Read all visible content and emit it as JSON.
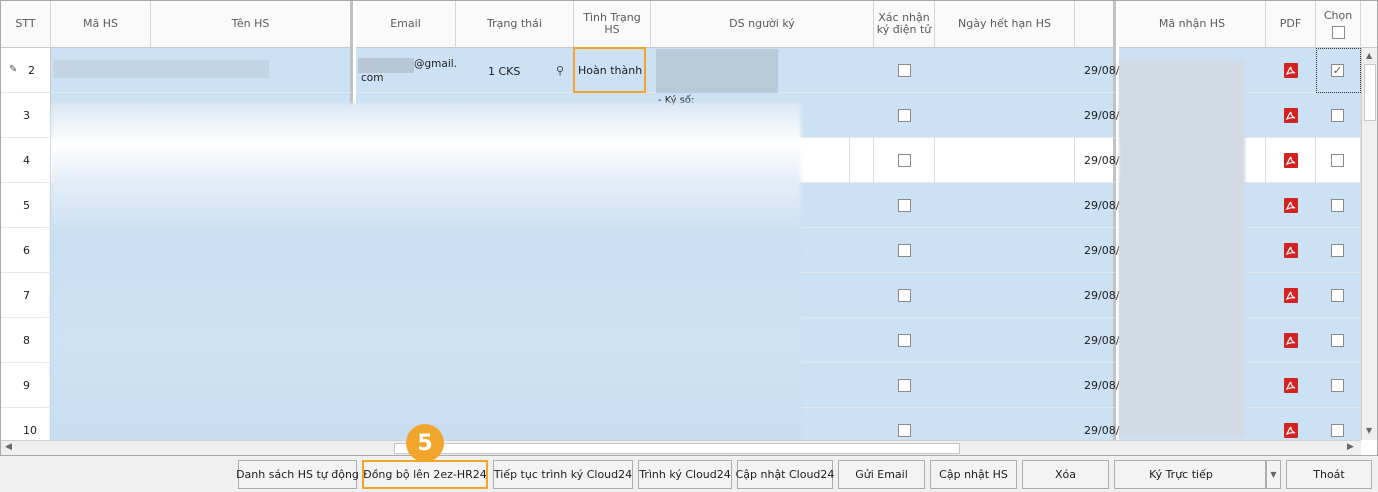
{
  "columns": {
    "stt": "STT",
    "ma_hs": "Mã HS",
    "ten_hs": "Tên HS",
    "email": "Email",
    "trang_thai": "Trạng thái",
    "tinh_trang_hs": "Tình Trạng HS",
    "ds_nguoi_ky": "DS người ký",
    "xac_nhan_1": "Xác nhận",
    "xac_nhan_2": "ký điện tử",
    "ngay_het_han": "Ngày hết hạn HS",
    "ma_nhan_hs": "Mã nhận HS",
    "pdf": "PDF",
    "chon": "Chọn"
  },
  "first_row": {
    "stt": "2",
    "email_line1": "@gmail.",
    "email_line2": "com",
    "trang_thai": "1 CKS",
    "tinh_trang": "Hoàn thành",
    "ds_partial": "- Ký số:"
  },
  "rows": [
    {
      "stt": "2",
      "date": "29/08/"
    },
    {
      "stt": "3",
      "date": "29/08/"
    },
    {
      "stt": "4",
      "date": "29/08/"
    },
    {
      "stt": "5",
      "date": "29/08/"
    },
    {
      "stt": "6",
      "date": "29/08/"
    },
    {
      "stt": "7",
      "date": "29/08/"
    },
    {
      "stt": "8",
      "date": "29/08/"
    },
    {
      "stt": "9",
      "date": "29/08/"
    },
    {
      "stt": "10",
      "date": "29/08/"
    }
  ],
  "step_badge": "5",
  "buttons": {
    "danh_sach": "Danh sách HS tự động",
    "dong_bo": "Đồng bộ lên 2ez-HR24",
    "tiep_tuc": "Tiếp tục trình ký Cloud24",
    "trinh_ky": "Trình ký Cloud24",
    "cap_nhat_cloud": "Cập nhật Cloud24",
    "gui_email": "Gửi Email",
    "cap_nhat_hs": "Cập nhật HS",
    "xoa": "Xóa",
    "ky_truc_tiep": "Ký Trực tiếp",
    "thoat": "Thoát"
  },
  "colors": {
    "selected_row": "#cce1f4",
    "highlight": "#f2a52b",
    "pdf_red": "#d32222"
  }
}
